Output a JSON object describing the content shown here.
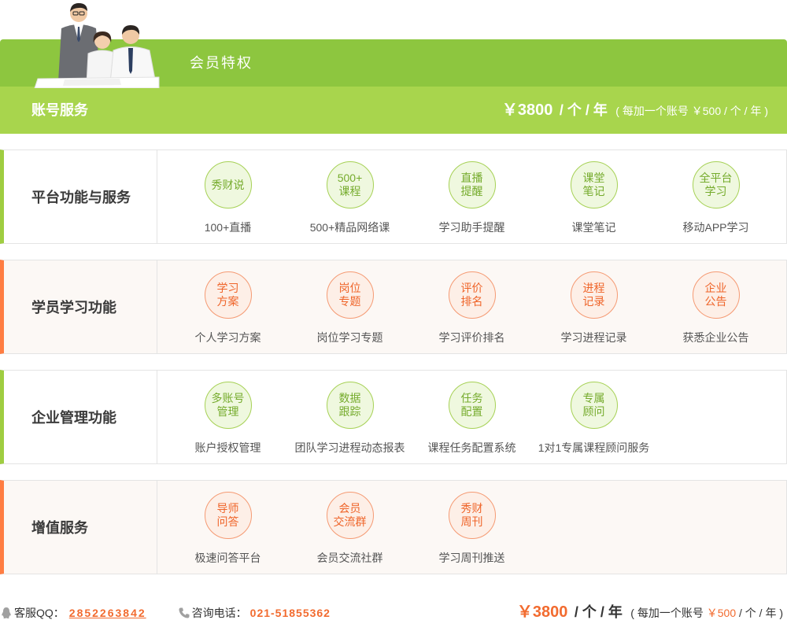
{
  "header": {
    "title": "会员特权",
    "service_label": "账号服务",
    "price": "￥3800",
    "price_unit": "/ 个 / 年",
    "extra_prefix": "( 每加一个账号 ",
    "extra_price": "￥500",
    "extra_suffix": " / 个 / 年 )"
  },
  "sections": [
    {
      "title": "平台功能与服务",
      "theme": "green",
      "items": [
        {
          "icon": [
            "秀财说"
          ],
          "label": "100+直播"
        },
        {
          "icon": [
            "500+",
            "课程"
          ],
          "label": "500+精品网络课"
        },
        {
          "icon": [
            "直播",
            "提醒"
          ],
          "label": "学习助手提醒"
        },
        {
          "icon": [
            "课堂",
            "笔记"
          ],
          "label": "课堂笔记"
        },
        {
          "icon": [
            "全平台",
            "学习"
          ],
          "label": "移动APP学习"
        }
      ]
    },
    {
      "title": "学员学习功能",
      "theme": "orange",
      "items": [
        {
          "icon": [
            "学习",
            "方案"
          ],
          "label": "个人学习方案"
        },
        {
          "icon": [
            "岗位",
            "专题"
          ],
          "label": "岗位学习专题"
        },
        {
          "icon": [
            "评价",
            "排名"
          ],
          "label": "学习评价排名"
        },
        {
          "icon": [
            "进程",
            "记录"
          ],
          "label": "学习进程记录"
        },
        {
          "icon": [
            "企业",
            "公告"
          ],
          "label": "获悉企业公告"
        }
      ]
    },
    {
      "title": "企业管理功能",
      "theme": "green",
      "items": [
        {
          "icon": [
            "多账号",
            "管理"
          ],
          "label": "账户授权管理"
        },
        {
          "icon": [
            "数据",
            "跟踪"
          ],
          "label": "团队学习进程动态报表"
        },
        {
          "icon": [
            "任务",
            "配置"
          ],
          "label": "课程任务配置系统"
        },
        {
          "icon": [
            "专属",
            "顾问"
          ],
          "label": "1对1专属课程顾问服务"
        }
      ]
    },
    {
      "title": "增值服务",
      "theme": "orange",
      "items": [
        {
          "icon": [
            "导师",
            "问答"
          ],
          "label": "极速问答平台"
        },
        {
          "icon": [
            "会员",
            "交流群"
          ],
          "label": "会员交流社群"
        },
        {
          "icon": [
            "秀财",
            "周刊"
          ],
          "label": "学习周刊推送"
        }
      ]
    }
  ],
  "footer": {
    "qq_label": "客服QQ：",
    "qq_number": "2852263842",
    "phone_label": "咨询电话：",
    "phone_number": "021-51855362",
    "price": "￥3800",
    "price_unit": "/ 个 / 年",
    "extra_prefix": "( 每加一个账号 ",
    "extra_price": "￥500",
    "extra_suffix": " / 个 / 年 )",
    "qq_icon": "qq-icon",
    "phone_icon": "phone-icon"
  },
  "colors": {
    "header_dark_green": "#8dc63f",
    "header_light_green": "#a8d54d",
    "green_accent": "#9fcd41",
    "orange_accent": "#ff7d42",
    "price_orange": "#f26b2f"
  }
}
